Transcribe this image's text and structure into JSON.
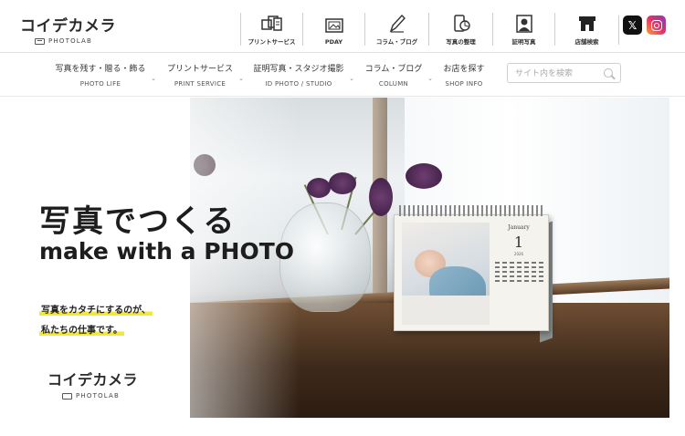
{
  "header": {
    "logo_text": "コイデカメラ",
    "logo_sub": "PHOTOLAB",
    "top_nav": [
      {
        "label": "プリントサービス",
        "icon": "print-icon"
      },
      {
        "label": "PDAY",
        "icon": "photo-frame-icon"
      },
      {
        "label": "コラム・ブログ",
        "icon": "pen-icon"
      },
      {
        "label": "写真の整理",
        "icon": "phone-photo-icon"
      },
      {
        "label": "証明写真",
        "icon": "id-photo-icon"
      },
      {
        "label": "店舗検索",
        "icon": "store-icon"
      }
    ],
    "social": [
      {
        "name": "x-icon",
        "glyph": "𝕏"
      },
      {
        "name": "instagram-icon",
        "glyph": ""
      }
    ]
  },
  "main_nav": [
    {
      "ja": "写真を残す・贈る・飾る",
      "en": "PHOTO LIFE"
    },
    {
      "ja": "プリントサービス",
      "en": "PRINT SERVICE"
    },
    {
      "ja": "証明写真・スタジオ撮影",
      "en": "ID PHOTO / STUDIO"
    },
    {
      "ja": "コラム・ブログ",
      "en": "COLUMN"
    },
    {
      "ja": "お店を探す",
      "en": "SHOP INFO"
    }
  ],
  "search": {
    "placeholder": "サイト内を検索",
    "value": ""
  },
  "hero": {
    "headline": "写真でつくる",
    "tagline": "make with a PHOTO",
    "copy_lines": [
      "写真をカタチにするのが、",
      "私たちの仕事です。"
    ],
    "logo_text": "コイデカメラ",
    "logo_sub": "PHOTOLAB",
    "calendar_month": "January",
    "calendar_day": "1",
    "calendar_year": "2026"
  },
  "colors": {
    "highlight": "#f0e83b",
    "text": "#1d1d1d",
    "border": "#e3e3e3"
  }
}
